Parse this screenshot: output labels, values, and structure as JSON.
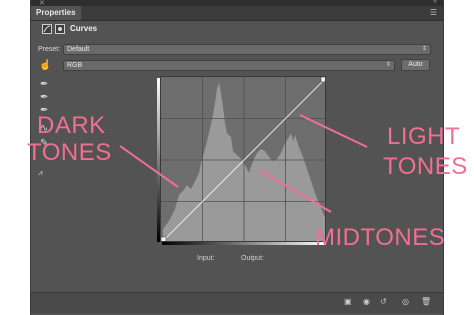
{
  "panel": {
    "title": "Properties",
    "adjustment_name": "Curves",
    "preset_label": "Preset:",
    "preset_value": "Default",
    "channel_value": "RGB",
    "auto_label": "Auto",
    "input_label": "Input:",
    "output_label": "Output:"
  },
  "annotations": {
    "dark_line1": "DARK",
    "dark_line2": "TONES",
    "light_line1": "LIGHT",
    "light_line2": "TONES",
    "mid": "MIDTONES"
  },
  "colors": {
    "annotation": "#f06f92",
    "panel_bg": "#535353",
    "histogram": "#9a9a9a"
  },
  "icons": [
    "curves-adjustment-icon",
    "mask-icon",
    "hand-target-icon",
    "black-eyedropper-icon",
    "gray-eyedropper-icon",
    "white-eyedropper-icon",
    "curve-pencil-icon",
    "smooth-icon",
    "clip-to-layer-icon",
    "view-previous-icon",
    "reset-icon",
    "visibility-eye-icon",
    "trash-icon",
    "panel-menu-icon"
  ]
}
